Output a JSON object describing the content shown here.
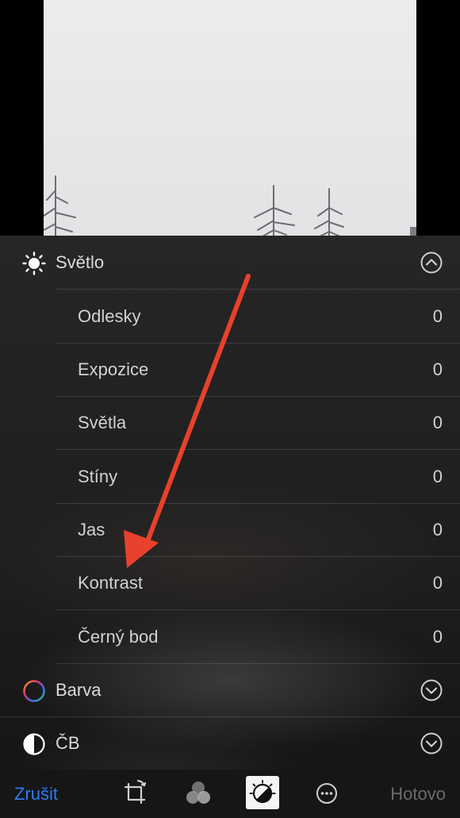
{
  "sections": {
    "light": {
      "label": "Světlo",
      "icon": "sun-icon",
      "state": "expanded"
    },
    "color": {
      "label": "Barva",
      "icon": "color-wheel-icon",
      "state": "collapsed"
    },
    "bw": {
      "label": "ČB",
      "icon": "half-circle-icon",
      "state": "collapsed"
    }
  },
  "light_items": [
    {
      "label": "Odlesky",
      "value": "0"
    },
    {
      "label": "Expozice",
      "value": "0"
    },
    {
      "label": "Světla",
      "value": "0"
    },
    {
      "label": "Stíny",
      "value": "0"
    },
    {
      "label": "Jas",
      "value": "0"
    },
    {
      "label": "Kontrast",
      "value": "0"
    },
    {
      "label": "Černý bod",
      "value": "0"
    }
  ],
  "toolbar": {
    "cancel_label": "Zrušit",
    "done_label": "Hotovo",
    "icons": [
      "crop-rotate-icon",
      "filters-icon",
      "adjust-dial-icon",
      "more-icon"
    ]
  },
  "colors": {
    "accent": "#2f7bf6",
    "annotation_arrow": "#e8412c",
    "panel": "#1e1e1e",
    "text": "#d8d8d8"
  }
}
